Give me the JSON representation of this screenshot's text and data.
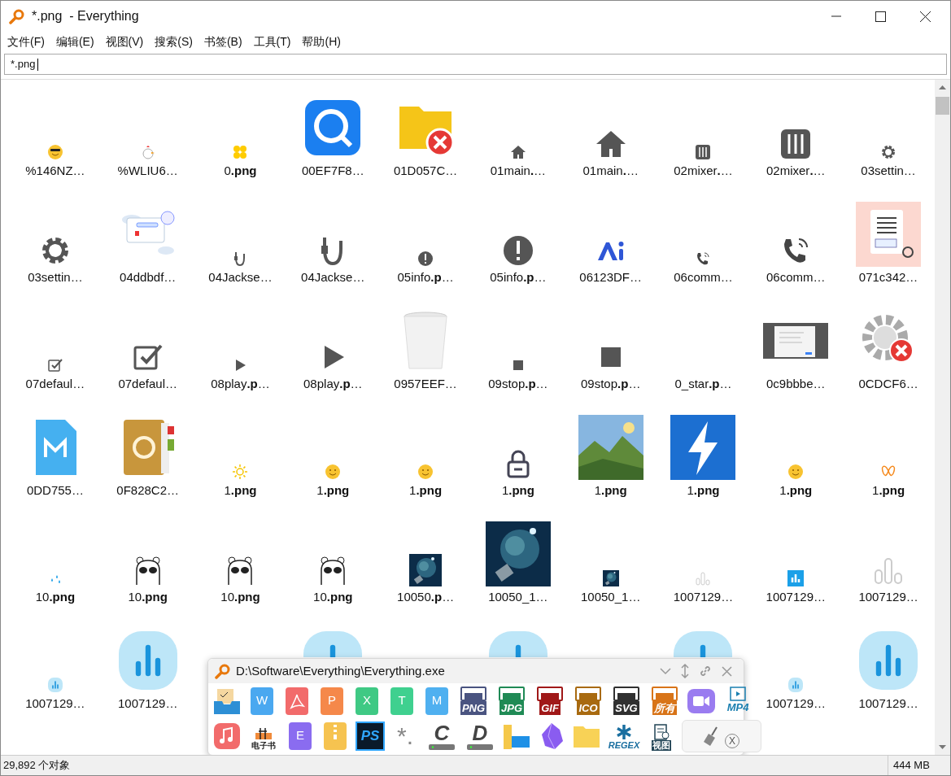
{
  "window": {
    "title": "*.png  - Everything"
  },
  "menu": [
    "文件(F)",
    "编辑(E)",
    "视图(V)",
    "搜索(S)",
    "书签(B)",
    "工具(T)",
    "帮助(H)"
  ],
  "search": {
    "value": "*.png"
  },
  "items": [
    {
      "kind": "file",
      "label": "%146NZ…"
    },
    {
      "kind": "file",
      "label": "%WLIU6…"
    },
    {
      "kind": "file",
      "label": "0**.png**"
    },
    {
      "kind": "file",
      "label": "00EF7F8…"
    },
    {
      "kind": "file",
      "label": "01D057C…"
    },
    {
      "kind": "file",
      "label": "01main**.**…"
    },
    {
      "kind": "file",
      "label": "01main**.**…"
    },
    {
      "kind": "file",
      "label": "02mixer**.**…"
    },
    {
      "kind": "file",
      "label": "02mixer**.**…"
    },
    {
      "kind": "file",
      "label": "03settin…"
    },
    {
      "kind": "file",
      "label": "03settin…"
    },
    {
      "kind": "file",
      "label": "04ddbdf…"
    },
    {
      "kind": "file",
      "label": "04Jackse…"
    },
    {
      "kind": "file",
      "label": "04Jackse…"
    },
    {
      "kind": "file",
      "label": "05info**.p**…"
    },
    {
      "kind": "file",
      "label": "05info**.p**…"
    },
    {
      "kind": "file",
      "label": "06123DF…"
    },
    {
      "kind": "file",
      "label": "06comm…"
    },
    {
      "kind": "file",
      "label": "06comm…"
    },
    {
      "kind": "file",
      "label": "071c342…"
    },
    {
      "kind": "file",
      "label": "07defaul…"
    },
    {
      "kind": "file",
      "label": "07defaul…"
    },
    {
      "kind": "file",
      "label": "08play**.p**…"
    },
    {
      "kind": "file",
      "label": "08play**.p**…"
    },
    {
      "kind": "file",
      "label": "0957EEF…"
    },
    {
      "kind": "file",
      "label": "09stop**.p**…"
    },
    {
      "kind": "file",
      "label": "09stop**.p**…"
    },
    {
      "kind": "file",
      "label": "0_star**.p**…"
    },
    {
      "kind": "file",
      "label": "0c9bbbe…"
    },
    {
      "kind": "file",
      "label": "0CDCF6…"
    },
    {
      "kind": "file",
      "label": "0DD755…"
    },
    {
      "kind": "file",
      "label": "0F828C2…"
    },
    {
      "kind": "file",
      "label": "1**.png**"
    },
    {
      "kind": "file",
      "label": "1**.png**"
    },
    {
      "kind": "file",
      "label": "1**.png**"
    },
    {
      "kind": "file",
      "label": "1**.png**"
    },
    {
      "kind": "file",
      "label": "1**.png**"
    },
    {
      "kind": "file",
      "label": "1**.png**"
    },
    {
      "kind": "file",
      "label": "1**.png**"
    },
    {
      "kind": "file",
      "label": "1**.png**"
    },
    {
      "kind": "file",
      "label": "10**.png**"
    },
    {
      "kind": "file",
      "label": "10**.png**"
    },
    {
      "kind": "file",
      "label": "10**.png**"
    },
    {
      "kind": "file",
      "label": "10**.png**"
    },
    {
      "kind": "file",
      "label": "10050**.p**…"
    },
    {
      "kind": "file",
      "label": "10050_1…"
    },
    {
      "kind": "file",
      "label": "10050_1…"
    },
    {
      "kind": "file",
      "label": "1007129…"
    },
    {
      "kind": "file",
      "label": "1007129…"
    },
    {
      "kind": "file",
      "label": "1007129…"
    },
    {
      "kind": "file",
      "label": "1007129…"
    },
    {
      "kind": "file",
      "label": "1007129…"
    },
    {
      "kind": "covered"
    },
    {
      "kind": "icon"
    },
    {
      "kind": "covered"
    },
    {
      "kind": "icon"
    },
    {
      "kind": "covered"
    },
    {
      "kind": "icon"
    },
    {
      "kind": "file",
      "label": "1007129…"
    },
    {
      "kind": "file",
      "label": "1007129…"
    }
  ],
  "launcher": {
    "title": "D:\\Software\\Everything\\Everything.exe",
    "rows": [
      [
        {
          "kind": "tray"
        },
        {
          "kind": "doc",
          "label": "W",
          "color": "#4aa8f0"
        },
        {
          "kind": "pdf",
          "color": "#f26b6b"
        },
        {
          "kind": "doc",
          "label": "P",
          "color": "#f5884a"
        },
        {
          "kind": "doc",
          "label": "X",
          "color": "#3fc984"
        },
        {
          "kind": "doc",
          "label": "T",
          "color": "#3fd08f"
        },
        {
          "kind": "doc",
          "label": "M",
          "color": "#4fb0f0"
        },
        {
          "kind": "badge",
          "label": "PNG",
          "color": "#4a5480"
        },
        {
          "kind": "badge",
          "label": "JPG",
          "color": "#1f8a55"
        },
        {
          "kind": "badge",
          "label": "GIF",
          "color": "#a01818"
        },
        {
          "kind": "badge",
          "label": "ICO",
          "color": "#a86a10"
        },
        {
          "kind": "badge",
          "label": "SVG",
          "color": "#303030"
        },
        {
          "kind": "badge",
          "label": "所有",
          "color": "#d87418"
        },
        {
          "kind": "video",
          "color": "#9a7cf0"
        },
        {
          "kind": "mp4",
          "label": "MP4"
        }
      ],
      [
        {
          "kind": "music",
          "color": "#f26b6b"
        },
        {
          "kind": "ebook",
          "label": "电子书"
        },
        {
          "kind": "doc",
          "label": "E",
          "color": "#8a6cf0"
        },
        {
          "kind": "zip",
          "color": "#f6c350"
        },
        {
          "kind": "ps",
          "label": "PS"
        },
        {
          "kind": "asterisk",
          "label": "*."
        },
        {
          "kind": "drive",
          "label": "C"
        },
        {
          "kind": "drive",
          "label": "D"
        },
        {
          "kind": "folder-screen"
        },
        {
          "kind": "crystal"
        },
        {
          "kind": "folder"
        },
        {
          "kind": "regex",
          "label": "REGEX"
        },
        {
          "kind": "view",
          "label": "视图"
        },
        {
          "kind": "clean",
          "label": "X"
        }
      ]
    ]
  },
  "status_bar": {
    "count": "29,892 个对象",
    "size": "444 MB"
  }
}
